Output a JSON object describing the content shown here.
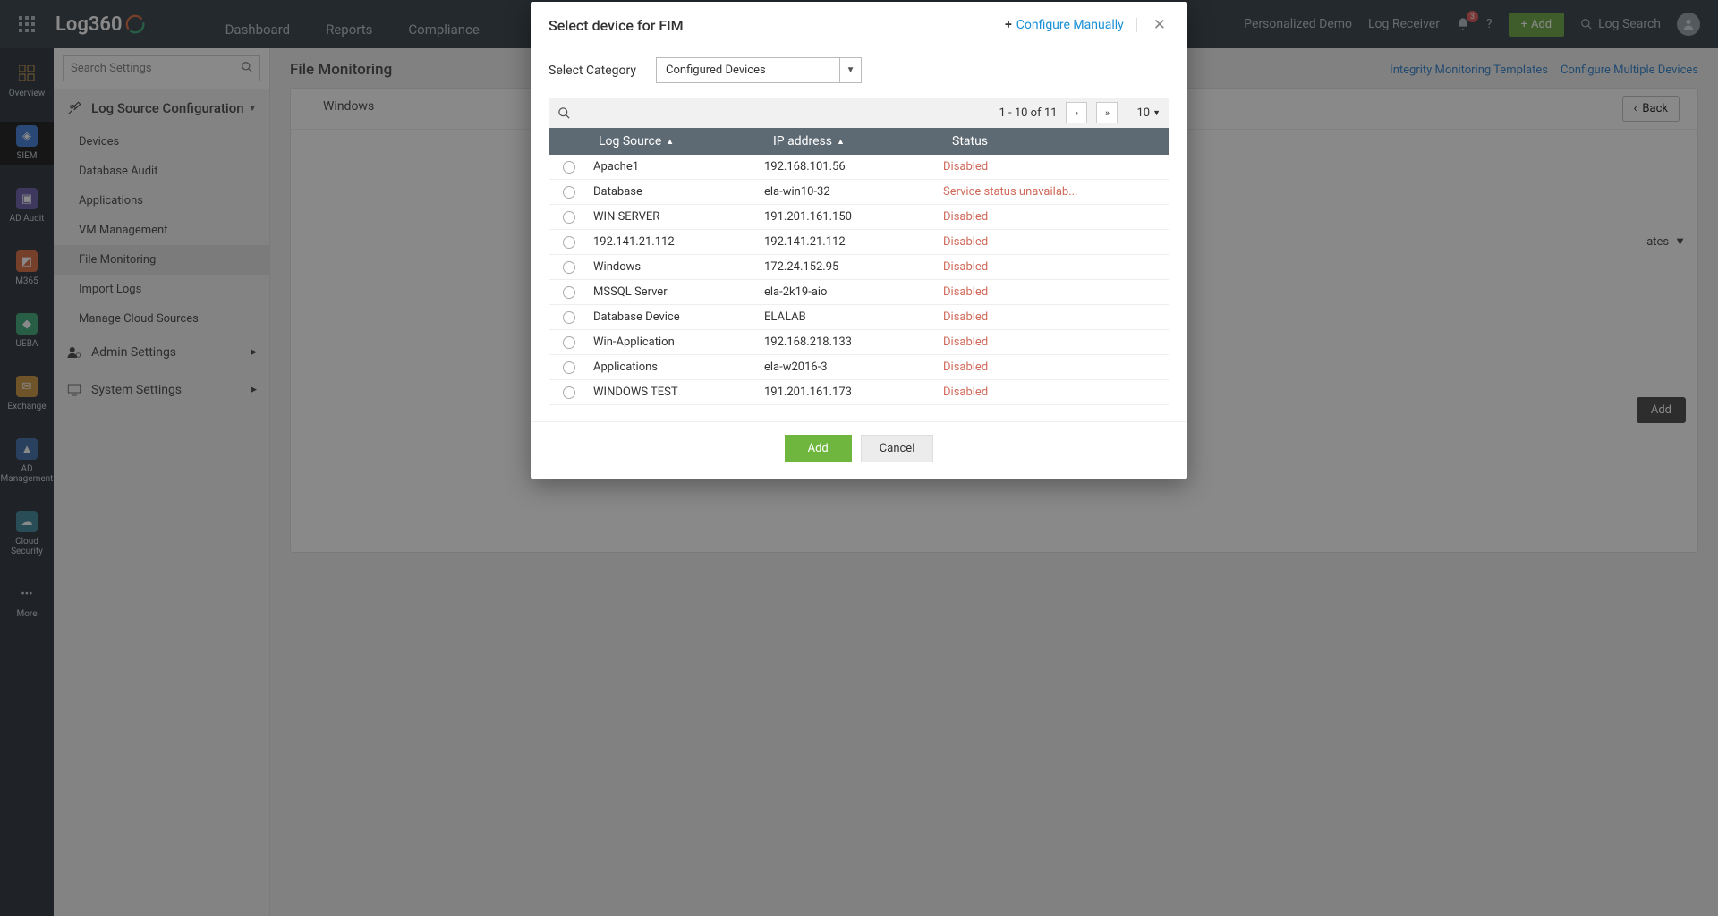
{
  "logo": "Log360",
  "top_tabs": [
    "Dashboard",
    "Reports",
    "Compliance"
  ],
  "header_right": {
    "demo": "Personalized Demo",
    "receiver": "Log Receiver",
    "bell_count": "3",
    "add": "Add",
    "log_search": "Log Search"
  },
  "rail": {
    "overview": "Overview",
    "siem": "SIEM",
    "adaudit": "AD Audit",
    "m365": "M365",
    "ueba": "UEBA",
    "exchange": "Exchange",
    "admgmt": "AD Management",
    "cloud": "Cloud Security",
    "more": "More"
  },
  "side": {
    "search_placeholder": "Search Settings",
    "log_source": "Log Source Configuration",
    "items": [
      "Devices",
      "Database Audit",
      "Applications",
      "VM Management",
      "File Monitoring",
      "Import Logs",
      "Manage Cloud Sources"
    ],
    "admin": "Admin Settings",
    "system": "System Settings"
  },
  "main": {
    "title": "File Monitoring",
    "integrity": "Integrity Monitoring Templates",
    "configure_multiple": "Configure Multiple Devices",
    "tab_windows": "Windows",
    "back": "Back",
    "templates": "ates",
    "add": "Add"
  },
  "modal": {
    "title": "Select device for FIM",
    "configure_manually": "Configure Manually",
    "select_category": "Select Category",
    "category_value": "Configured Devices",
    "pagination": "1 - 10 of 11",
    "page_size": "10",
    "col_logsource": "Log Source",
    "col_ip": "IP address",
    "col_status": "Status",
    "rows": [
      {
        "ls": "Apache1",
        "ip": "192.168.101.56",
        "status": "Disabled"
      },
      {
        "ls": "Database",
        "ip": "ela-win10-32",
        "status": "Service status unavailab..."
      },
      {
        "ls": "WIN SERVER",
        "ip": "191.201.161.150",
        "status": "Disabled"
      },
      {
        "ls": "192.141.21.112",
        "ip": "192.141.21.112",
        "status": "Disabled"
      },
      {
        "ls": "Windows",
        "ip": "172.24.152.95",
        "status": "Disabled"
      },
      {
        "ls": "MSSQL Server",
        "ip": "ela-2k19-aio",
        "status": "Disabled"
      },
      {
        "ls": "Database Device",
        "ip": "ELALAB",
        "status": "Disabled"
      },
      {
        "ls": "Win-Application",
        "ip": "192.168.218.133",
        "status": "Disabled"
      },
      {
        "ls": "Applications",
        "ip": "ela-w2016-3",
        "status": "Disabled"
      },
      {
        "ls": "WINDOWS TEST",
        "ip": "191.201.161.173",
        "status": "Disabled"
      }
    ],
    "btn_add": "Add",
    "btn_cancel": "Cancel"
  }
}
